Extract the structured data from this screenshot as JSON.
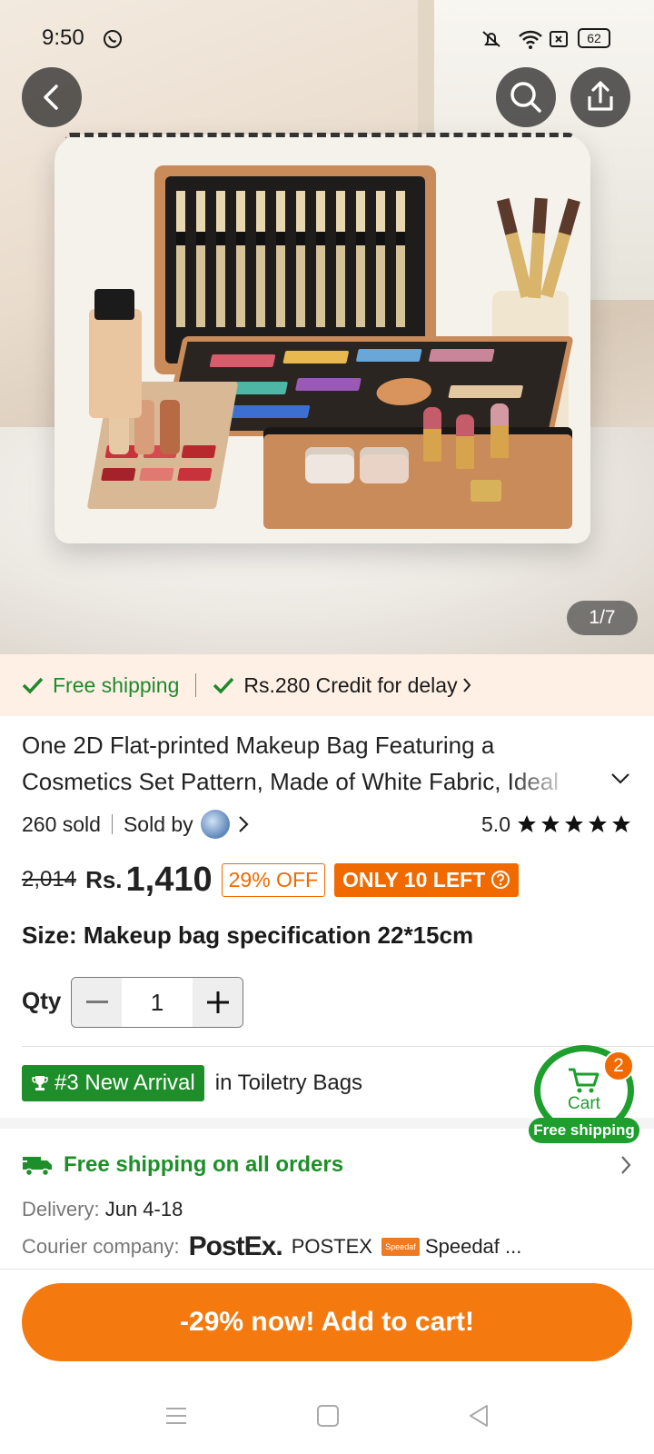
{
  "status_bar": {
    "time": "9:50",
    "battery": "62"
  },
  "gallery": {
    "counter": "1/7"
  },
  "shipping_banner": {
    "free_shipping": "Free shipping",
    "credit": "Rs.280 Credit for delay"
  },
  "product": {
    "title": "One 2D Flat-printed Makeup Bag Featuring a Cosmetics Set Pattern, Made of White Fabric, Ideal",
    "sold": "260 sold",
    "sold_by": "Sold by",
    "rating": "5.0",
    "old_price": "2,014",
    "currency": "Rs.",
    "price": "1,410",
    "discount": "29% OFF",
    "stock": "ONLY 10 LEFT",
    "size_label": "Size:",
    "size_value": "Makeup bag specification 22*15cm",
    "qty_label": "Qty",
    "qty_value": "1"
  },
  "ranking": {
    "badge": "#3 New Arrival",
    "category": "in Toiletry Bags"
  },
  "floating_cart": {
    "count": "2",
    "label": "Cart",
    "shipping": "Free shipping"
  },
  "delivery": {
    "free_all": "Free shipping on all orders",
    "label": "Delivery:",
    "dates": "Jun 4-18",
    "courier_label": "Courier company:",
    "postex_logo": "PostEx.",
    "postex": "POSTEX",
    "speedaf_logo": "Speedaf",
    "speedaf": "Speedaf ..."
  },
  "cta": {
    "add_to_cart": "-29% now! Add to cart!"
  },
  "colors": {
    "accent": "#f47a10",
    "green": "#1e8e2a"
  }
}
